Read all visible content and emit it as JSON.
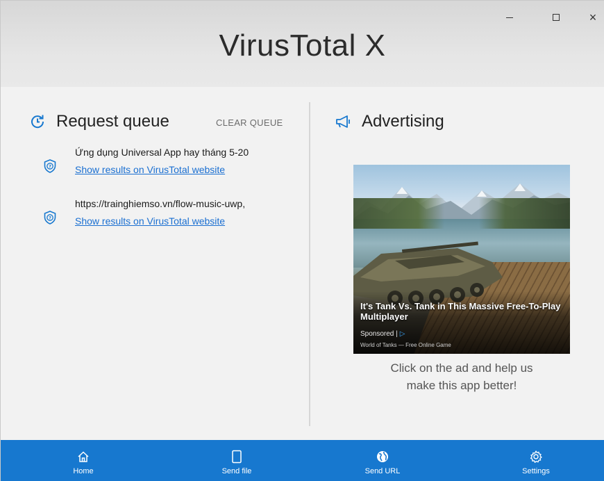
{
  "window": {
    "title": "VirusTotal X",
    "controls": {
      "minimize": "–",
      "maximize": "□",
      "close": "×"
    }
  },
  "queue": {
    "title": "Request queue",
    "clear_label": "CLEAR QUEUE",
    "icon": "history-refresh-icon",
    "items": [
      {
        "name": "Ứng dụng Universal App hay tháng 5-20",
        "link": "Show results on VirusTotal website",
        "icon": "shield-question-icon"
      },
      {
        "name": "https://trainghiemso.vn/flow-music-uwp,",
        "link": "Show results on VirusTotal website",
        "icon": "shield-question-icon"
      }
    ]
  },
  "advertising": {
    "title": "Advertising",
    "icon": "megaphone-icon",
    "ad": {
      "headline": "It's Tank Vs. Tank in This Massive Free-To-Play Multiplayer",
      "sponsored": "Sponsored |",
      "adchoices": "▷",
      "source": "World of Tanks — Free Online Game"
    },
    "caption_line1": "Click on the ad and help us",
    "caption_line2": "make this app better!"
  },
  "nav": {
    "items": [
      {
        "label": "Home",
        "icon": "home-icon"
      },
      {
        "label": "Send file",
        "icon": "file-icon"
      },
      {
        "label": "Send URL",
        "icon": "globe-icon"
      },
      {
        "label": "Settings",
        "icon": "gear-icon"
      }
    ]
  },
  "colors": {
    "accent": "#1778cf",
    "link": "#1a6fd1",
    "background": "#f2f2f2"
  }
}
